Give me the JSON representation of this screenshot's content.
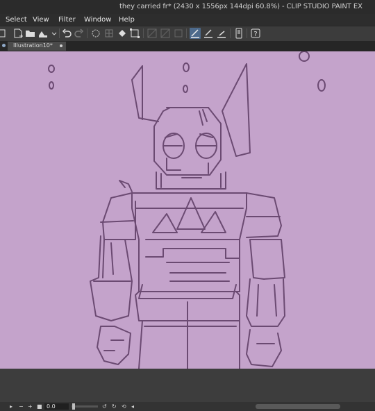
{
  "window": {
    "title": "they carried fr* (2430 x 1556px 144dpi 60.8%)  - CLIP STUDIO PAINT EX"
  },
  "menu": {
    "items": [
      "Select",
      "View",
      "Filter",
      "Window",
      "Help"
    ]
  },
  "tabs": {
    "document": "Illustration10*"
  },
  "status": {
    "zoom_value": "0.0"
  },
  "colors": {
    "canvas_bg": "#c4a3cb",
    "stroke": "#6b4a72",
    "accent": "#4d6a8c"
  },
  "icons": [
    "new-canvas-icon",
    "open-icon",
    "save-icon",
    "undo-icon",
    "redo-icon",
    "transform-icon",
    "fill-icon",
    "select-icon",
    "ruler-icon",
    "pen-icon",
    "eraser-icon",
    "device-icon",
    "help-icon"
  ]
}
